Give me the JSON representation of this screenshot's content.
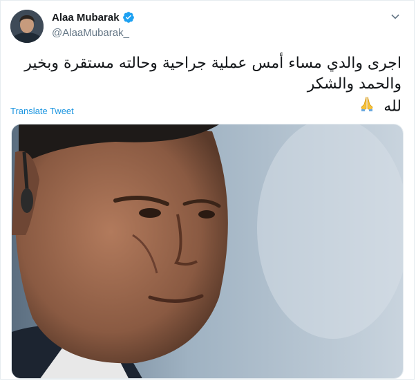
{
  "tweet": {
    "author": {
      "display_name": "Alaa Mubarak",
      "handle": "@AlaaMubarak_",
      "verified": true,
      "avatar_icon": "profile-photo"
    },
    "text_line1": "اجرى والدي مساء أمس عملية جراحية وحالته مستقرة وبخير والحمد والشكر",
    "text_line2": "لله",
    "emoji_icon": "folded-hands-icon",
    "translate_label": "Translate Tweet",
    "menu_icon": "chevron-down-icon",
    "media_icon": "photo"
  },
  "colors": {
    "link": "#1b95e0",
    "verified": "#1da1f2",
    "secondary_text": "#657786",
    "border": "#e6ecf0"
  }
}
